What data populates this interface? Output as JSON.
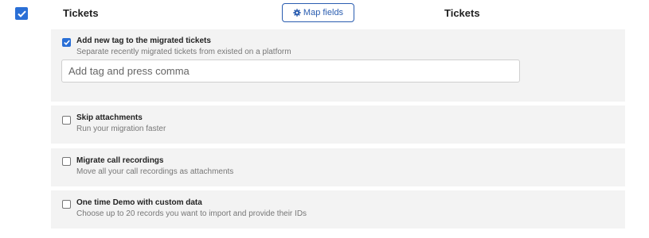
{
  "header": {
    "source_title": "Tickets",
    "target_title": "Tickets",
    "map_fields_label": "Map fields",
    "main_checked": true
  },
  "options": [
    {
      "title": "Add new tag to the migrated tickets",
      "description": "Separate recently migrated tickets from existed on a platform",
      "checked": true,
      "input_placeholder": "Add tag and press comma"
    },
    {
      "title": "Skip attachments",
      "description": "Run your migration faster",
      "checked": false
    },
    {
      "title": "Migrate call recordings",
      "description": "Move all your call recordings as attachments",
      "checked": false
    },
    {
      "title": "One time Demo with custom data",
      "description": "Choose up to 20 records you want to import and provide their IDs",
      "checked": false
    }
  ],
  "colors": {
    "accent": "#2a6fd6",
    "button_border": "#2a5db0",
    "panel_bg": "#f3f3f3"
  }
}
